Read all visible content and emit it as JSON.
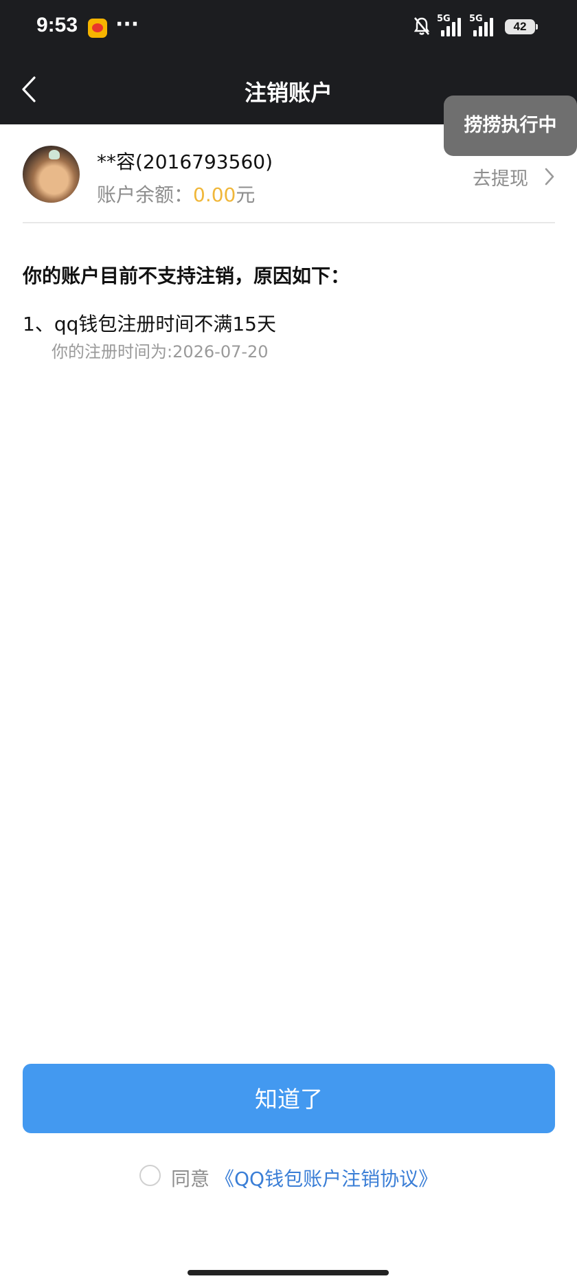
{
  "status_bar": {
    "time": "9:53",
    "more": "···",
    "network_1": "5G",
    "network_2": "5G",
    "battery": "42"
  },
  "nav": {
    "title": "注销账户"
  },
  "overlay": {
    "text": "捞捞执行中"
  },
  "account": {
    "name": "**容(2016793560)",
    "balance_label": "账户余额：",
    "balance_amount": "0.00",
    "balance_unit": "元",
    "withdraw_label": "去提现"
  },
  "reasons": {
    "header": "你的账户目前不支持注销，原因如下：",
    "items": [
      {
        "text": "1、qq钱包注册时间不满15天",
        "detail": "你的注册时间为:2026-07-20"
      }
    ]
  },
  "footer": {
    "confirm_label": "知道了",
    "agree_label": "同意",
    "agreement_link": "《QQ钱包账户注销协议》"
  },
  "colors": {
    "header_bg": "#1c1d20",
    "accent_blue": "#4399f0",
    "link_blue": "#3a7ed6",
    "balance_gold": "#f0b73a"
  }
}
